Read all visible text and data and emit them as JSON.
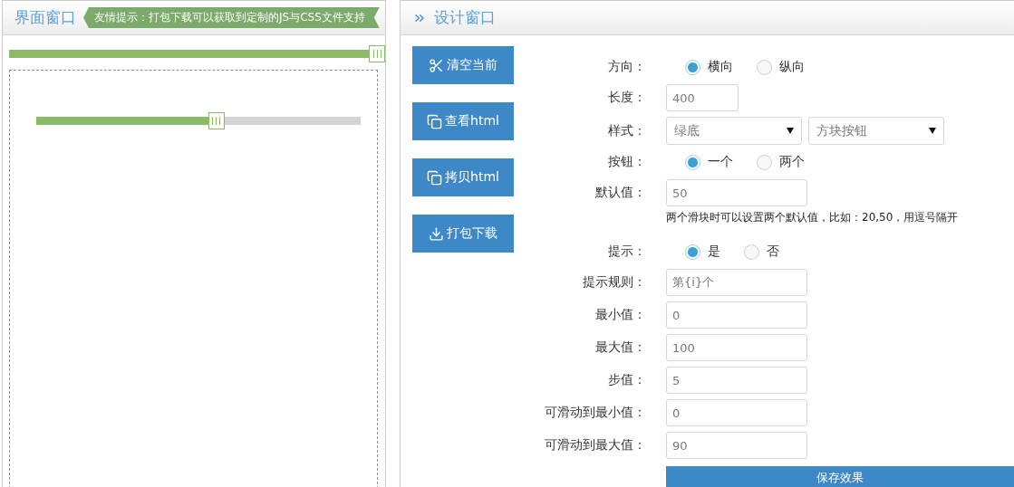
{
  "left_panel": {
    "title": "界面窗口",
    "tip": "友情提示：打包下载可以获取到定制的JS与CSS文件支持",
    "sliders": [
      {
        "kind": "full",
        "level": 1
      },
      {
        "kind": "inset",
        "level": 0.53
      }
    ]
  },
  "right_panel": {
    "title": "设计窗口",
    "actions": [
      {
        "kind": "scissors",
        "label": "清空当前"
      },
      {
        "kind": "copy",
        "label": "查看html"
      },
      {
        "kind": "copy",
        "label": "拷贝html"
      },
      {
        "kind": "download",
        "label": "打包下载"
      }
    ],
    "form": [
      {
        "kind": "radio",
        "label": "方向：",
        "options": [
          {
            "label": "横向",
            "selected": true
          },
          {
            "label": "纵向",
            "selected": false
          }
        ]
      },
      {
        "kind": "short-input",
        "label": "长度：",
        "value": "400"
      },
      {
        "kind": "selects",
        "label": "样式：",
        "selects": [
          {
            "value": "绿底"
          },
          {
            "value": "方块按钮"
          }
        ]
      },
      {
        "kind": "radio",
        "label": "按钮：",
        "options": [
          {
            "label": "一个",
            "selected": true
          },
          {
            "label": "两个",
            "selected": false
          }
        ]
      },
      {
        "kind": "input",
        "label": "默认值：",
        "value": "50",
        "hint": "两个滑块时可以设置两个默认值，比如：20,50，用逗号隔开"
      },
      {
        "kind": "radio",
        "label": "提示：",
        "options": [
          {
            "label": "是",
            "selected": true
          },
          {
            "label": "否",
            "selected": false
          }
        ]
      },
      {
        "kind": "input",
        "label": "提示规则：",
        "value": "第{i}个"
      },
      {
        "kind": "input",
        "label": "最小值：",
        "value": "0"
      },
      {
        "kind": "input",
        "label": "最大值：",
        "value": "100"
      },
      {
        "kind": "input",
        "label": "步值：",
        "value": "5"
      },
      {
        "kind": "input",
        "label": "可滑动到最小值：",
        "value": "0"
      },
      {
        "kind": "input",
        "label": "可滑动到最大值：",
        "value": "90"
      }
    ],
    "save_button": "保存效果"
  }
}
